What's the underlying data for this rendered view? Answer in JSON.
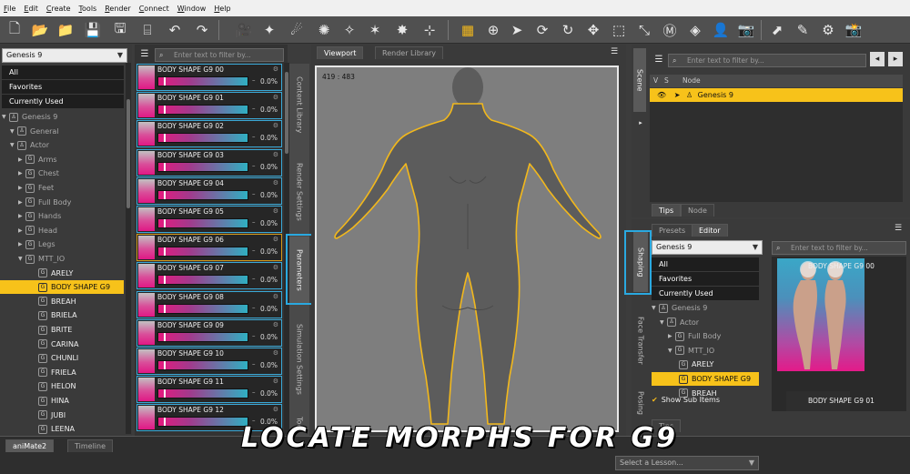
{
  "menu": [
    "File",
    "Edit",
    "Create",
    "Tools",
    "Render",
    "Connect",
    "Window",
    "Help"
  ],
  "library": {
    "combo": "Genesis 9",
    "filters": [
      "All",
      "Favorites",
      "Currently Used"
    ],
    "tree": [
      {
        "label": "Genesis 9",
        "level": 0
      },
      {
        "label": "General",
        "level": 1
      },
      {
        "label": "Actor",
        "level": 1
      },
      {
        "label": "Arms",
        "level": 2
      },
      {
        "label": "Chest",
        "level": 2
      },
      {
        "label": "Feet",
        "level": 2
      },
      {
        "label": "Full Body",
        "level": 2
      },
      {
        "label": "Hands",
        "level": 2
      },
      {
        "label": "Head",
        "level": 2
      },
      {
        "label": "Legs",
        "level": 2
      },
      {
        "label": "MTT_IO",
        "level": 2
      },
      {
        "label": "ARELY",
        "level": 3
      },
      {
        "label": "BODY SHAPE G9",
        "level": 3
      },
      {
        "label": "BREAH",
        "level": 3
      },
      {
        "label": "BRIELA",
        "level": 3
      },
      {
        "label": "BRITE",
        "level": 3
      },
      {
        "label": "CARINA",
        "level": 3
      },
      {
        "label": "CHUNLI",
        "level": 3
      },
      {
        "label": "FRIELA",
        "level": 3
      },
      {
        "label": "HELON",
        "level": 3
      },
      {
        "label": "HINA",
        "level": 3
      },
      {
        "label": "JUBI",
        "level": 3
      },
      {
        "label": "LEENA",
        "level": 3
      }
    ]
  },
  "morphs": {
    "search_placeholder": "Enter text to filter by...",
    "items": [
      {
        "label": "BODY SHAPE G9 00",
        "value": "0.0%"
      },
      {
        "label": "BODY SHAPE G9 01",
        "value": "0.0%"
      },
      {
        "label": "BODY SHAPE G9 02",
        "value": "0.0%"
      },
      {
        "label": "BODY SHAPE G9 03",
        "value": "0.0%"
      },
      {
        "label": "BODY SHAPE G9 04",
        "value": "0.0%"
      },
      {
        "label": "BODY SHAPE G9 05",
        "value": "0.0%"
      },
      {
        "label": "BODY SHAPE G9 06",
        "value": "0.0%"
      },
      {
        "label": "BODY SHAPE G9 07",
        "value": "0.0%"
      },
      {
        "label": "BODY SHAPE G9 08",
        "value": "0.0%"
      },
      {
        "label": "BODY SHAPE G9 09",
        "value": "0.0%"
      },
      {
        "label": "BODY SHAPE G9 10",
        "value": "0.0%"
      },
      {
        "label": "BODY SHAPE G9 11",
        "value": "0.0%"
      },
      {
        "label": "BODY SHAPE G9 12",
        "value": "0.0%"
      }
    ]
  },
  "left_vtabs": [
    "Content Library",
    "Render Settings",
    "Parameters",
    "Simulation Settings",
    "Tool"
  ],
  "viewport": {
    "tabs": [
      "Viewport",
      "Render Library"
    ],
    "dims": "419 : 483"
  },
  "scene": {
    "vtab": "Scene",
    "search_placeholder": "Enter text to filter by...",
    "header": [
      "V",
      "S",
      "Node"
    ],
    "row_label": "Genesis 9",
    "bottom_tabs": [
      "Tips",
      "Node"
    ]
  },
  "shaping": {
    "top_tabs": [
      "Presets",
      "Editor"
    ],
    "combo": "Genesis 9",
    "vtabs": [
      "Shaping",
      "Face Transfer",
      "Posing"
    ],
    "filters": [
      "All",
      "Favorites",
      "Currently Used"
    ],
    "tree": [
      {
        "label": "Genesis 9",
        "level": 0
      },
      {
        "label": "Actor",
        "level": 1
      },
      {
        "label": "Full Body",
        "level": 2
      },
      {
        "label": "MTT_IO",
        "level": 2
      },
      {
        "label": "ARELY",
        "level": 3
      },
      {
        "label": "BODY SHAPE G9",
        "level": 3
      },
      {
        "label": "BREAH",
        "level": 3
      }
    ],
    "show_sub_items": "Show Sub Items",
    "search_placeholder": "Enter text to filter by...",
    "preview_labels": [
      "BODY SHAPE G9 00",
      "BODY SHAPE G9 01"
    ],
    "tips_tab": "Tips"
  },
  "bottom": {
    "tabs": [
      "aniMate2",
      "Timeline"
    ],
    "lesson_placeholder": "Select a Lesson..."
  },
  "caption": "LOCATE MORPHS FOR G9",
  "colors": {
    "accent": "#f7c21a",
    "highlight": "#2aa9e0",
    "slider_pink": "#e6197f"
  }
}
